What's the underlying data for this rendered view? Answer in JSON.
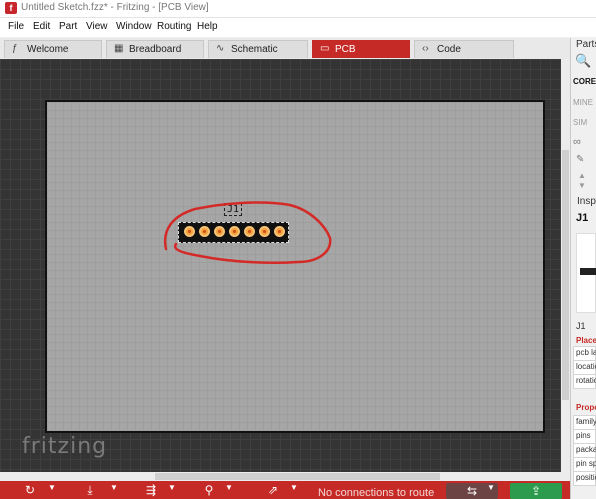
{
  "window": {
    "title": "Untitled Sketch.fzz* - Fritzing - [PCB View]",
    "app_icon_letter": "f"
  },
  "menu": [
    "File",
    "Edit",
    "Part",
    "View",
    "Window",
    "Routing",
    "Help"
  ],
  "tabs": [
    {
      "label": "Welcome",
      "icon": "fritzing-f-icon",
      "active": false
    },
    {
      "label": "Breadboard",
      "icon": "breadboard-icon",
      "active": false
    },
    {
      "label": "Schematic",
      "icon": "schematic-icon",
      "active": false
    },
    {
      "label": "PCB",
      "icon": "pcb-icon",
      "active": true
    },
    {
      "label": "Code",
      "icon": "code-icon",
      "active": false
    }
  ],
  "canvas": {
    "part_label": "J1",
    "pin_count": 7,
    "watermark": "fritzing",
    "annotation_color": "#d42a27"
  },
  "status": {
    "no_connections": "No connections to route"
  },
  "colors": {
    "accent": "#c62a27",
    "export_button": "#2d9b4e",
    "board": "#a6a6a6",
    "canvas_bg": "#343434",
    "pin": "#f2a33a"
  },
  "parts_panel": {
    "title": "Parts",
    "bins": [
      "CORE",
      "MINE",
      "SIM"
    ]
  },
  "inspector": {
    "title": "Insp",
    "part_title": "J1",
    "part_caption": "J1",
    "placement_header": "Place",
    "placement_fields": [
      "pcb lay",
      "locatio",
      "rotatio"
    ],
    "properties_header": "Prope",
    "property_fields": [
      "family",
      "pins",
      "packag",
      "pin sp",
      "positio"
    ]
  }
}
